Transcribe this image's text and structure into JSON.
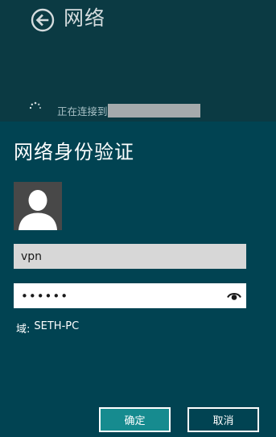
{
  "pane": {
    "title": "网络",
    "status_text": "正在连接到"
  },
  "dialog": {
    "title": "网络身份验证",
    "username": {
      "value": "vpn"
    },
    "password": {
      "masked_value": "••••••"
    },
    "domain_label": "域:",
    "domain_value": "SETH-PC",
    "ok_label": "确定",
    "cancel_label": "取消"
  },
  "icons": {
    "back": "back-arrow-circle-icon",
    "spinner": "loading-spinner-icon",
    "avatar": "user-silhouette-icon",
    "reveal": "eye-icon"
  },
  "colors": {
    "top_pane_bg": "#0b3a43",
    "dialog_bg": "#014352",
    "ok_button_bg": "#168b8f",
    "text": "#ffffff"
  }
}
